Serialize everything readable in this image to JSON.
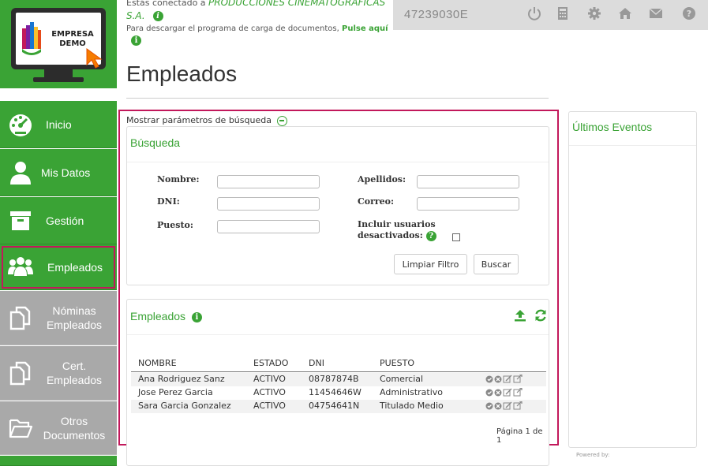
{
  "header": {
    "connected_prefix": "Estás conectado a",
    "company_line1": "PRODUCCIONES CINEMATOGRÁFICAS",
    "company_line2": "S.A.",
    "download_text": "Para descargar el programa de carga de documentos,",
    "download_link": "Pulse aquí",
    "user_id": "47239030E"
  },
  "logo": {
    "line1": "EMPRESA",
    "line2": "DEMO"
  },
  "sidebar": {
    "items": [
      {
        "label": "Inicio",
        "icon": "dashboard-gauge-icon"
      },
      {
        "label": "Mis Datos",
        "icon": "user-icon"
      },
      {
        "label": "Gestión",
        "icon": "archive-box-icon"
      },
      {
        "label": "Empleados",
        "icon": "users-group-icon",
        "active": true
      },
      {
        "label_line1": "Nóminas",
        "label_line2": "Empleados",
        "icon": "documents-icon"
      },
      {
        "label_line1": "Cert.",
        "label_line2": "Empleados",
        "icon": "documents-icon"
      },
      {
        "label_line1": "Otros",
        "label_line2": "Documentos",
        "icon": "folder-open-icon"
      }
    ]
  },
  "topbar_icons": [
    "power-icon",
    "calculator-icon",
    "gear-icon",
    "home-icon",
    "envelope-icon",
    "help-icon"
  ],
  "page": {
    "title": "Empleados"
  },
  "search": {
    "toggle_label": "Mostrar parámetros de búsqueda",
    "title": "Búsqueda",
    "labels": {
      "nombre": "Nombre:",
      "apellidos": "Apellidos:",
      "dni": "DNI:",
      "correo": "Correo:",
      "puesto": "Puesto:",
      "inactive_line1": "Incluir usuarios",
      "inactive_line2": "desactivados:"
    },
    "values": {
      "nombre": "",
      "apellidos": "",
      "dni": "",
      "correo": "",
      "puesto": ""
    },
    "include_inactive": false,
    "clear_button": "Limpiar Filtro",
    "search_button": "Buscar"
  },
  "employees": {
    "title": "Empleados",
    "columns": [
      "NOMBRE",
      "ESTADO",
      "DNI",
      "PUESTO"
    ],
    "rows": [
      {
        "nombre": "Ana  Rodriguez Sanz",
        "estado": "ACTIVO",
        "dni": "08787874B",
        "puesto": "Comercial"
      },
      {
        "nombre": "Jose  Perez Garcia",
        "estado": "ACTIVO",
        "dni": "11454646W",
        "puesto": "Administrativo"
      },
      {
        "nombre": "Sara  Garcia Gonzalez",
        "estado": "ACTIVO",
        "dni": "04754641N",
        "puesto": "Titulado Medio"
      }
    ],
    "pagination": "Página 1 de 1"
  },
  "events": {
    "title": "Últimos Eventos"
  },
  "footer": {
    "powered_by": "Powered by:"
  },
  "colors": {
    "brand_green": "#3aa335",
    "highlight": "#c2185b",
    "sidebar_gray": "#a9a9a9"
  }
}
